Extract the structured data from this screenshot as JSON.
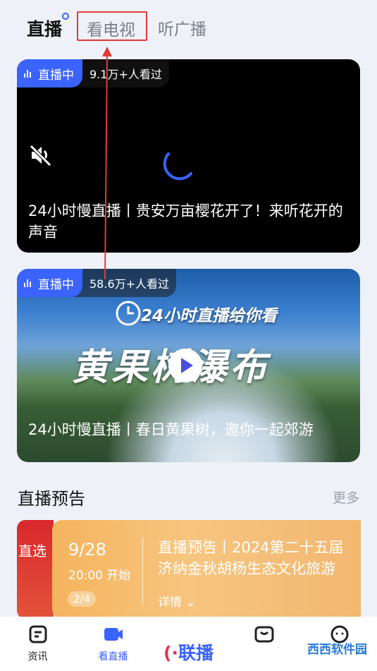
{
  "top_tabs": {
    "live": "直播",
    "tv": "看电视",
    "radio": "听广播"
  },
  "cards": [
    {
      "badge": "直播中",
      "viewers": "9.1万+人看过",
      "title": "24小时慢直播丨贵安万亩樱花开了！来听花开的声音"
    },
    {
      "badge": "直播中",
      "viewers": "58.6万+人看过",
      "title": "24小时慢直播丨春日黄果树，邀你一起郊游",
      "poster_sub": "24小时直播给你看",
      "poster_main": "黄果树瀑布"
    }
  ],
  "preview": {
    "section_title": "直播预告",
    "more": "更多",
    "left_label": "直选",
    "date": "9/28",
    "time": "20:00 开始",
    "page": "2/4",
    "line1": "直播预告丨2024第二十五届",
    "line2": "济纳金秋胡杨生态文化旅游",
    "detail": "详情"
  },
  "bottom_nav": {
    "news": "资讯",
    "live": "看直播",
    "brand": "联播",
    "brand_mark": "(·",
    "watermark": "西西软件园"
  },
  "colors": {
    "accent": "#3a63ff",
    "highlight": "#e23a3a"
  }
}
